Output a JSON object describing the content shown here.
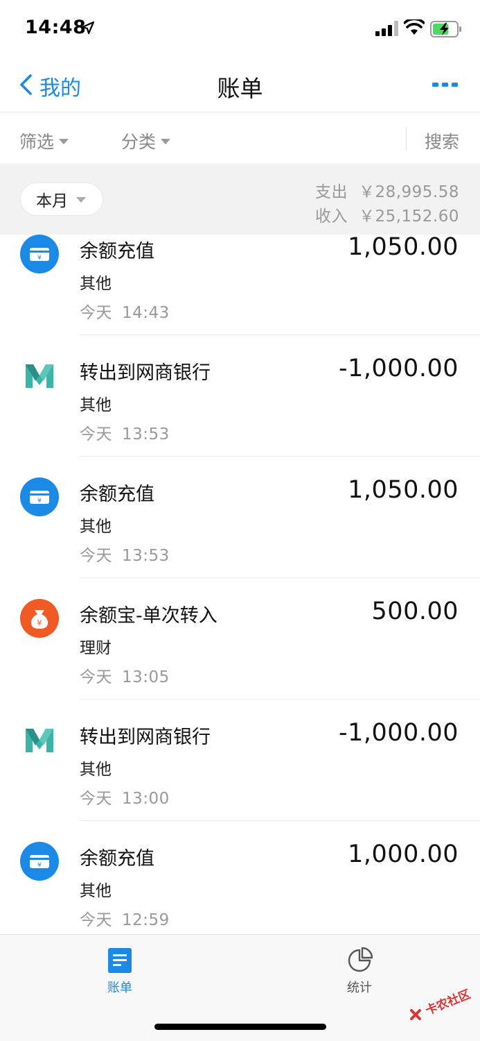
{
  "status_bar": {
    "time": "14:48"
  },
  "nav": {
    "back_label": "我的",
    "title": "账单"
  },
  "filters": {
    "filter_label": "筛选",
    "category_label": "分类",
    "search_label": "搜索"
  },
  "summary": {
    "period": "本月",
    "expense_label": "支出",
    "expense_amount": "￥28,995.58",
    "income_label": "收入",
    "income_amount": "￥25,152.60"
  },
  "transactions": [
    {
      "title": "余额充值",
      "category": "其他",
      "day": "今天",
      "time": "14:43",
      "amount": "1,050.00",
      "icon": "balance-card-icon"
    },
    {
      "title": "转出到网商银行",
      "category": "其他",
      "day": "今天",
      "time": "13:53",
      "amount": "-1,000.00",
      "icon": "mybank-logo-icon"
    },
    {
      "title": "余额充值",
      "category": "其他",
      "day": "今天",
      "time": "13:53",
      "amount": "1,050.00",
      "icon": "balance-card-icon"
    },
    {
      "title": "余额宝-单次转入",
      "category": "理财",
      "day": "今天",
      "time": "13:05",
      "amount": "500.00",
      "icon": "yuebao-moneybag-icon"
    },
    {
      "title": "转出到网商银行",
      "category": "其他",
      "day": "今天",
      "time": "13:00",
      "amount": "-1,000.00",
      "icon": "mybank-logo-icon"
    },
    {
      "title": "余额充值",
      "category": "其他",
      "day": "今天",
      "time": "12:59",
      "amount": "1,000.00",
      "icon": "balance-card-icon"
    }
  ],
  "tabs": [
    {
      "label": "账单",
      "icon": "bill-list-icon",
      "active": true
    },
    {
      "label": "统计",
      "icon": "pie-chart-icon",
      "active": false
    }
  ],
  "watermark": {
    "text": "卡农社区"
  },
  "colors": {
    "accent": "#1a8ae6",
    "yuebao": "#f05a24",
    "mybank": "#3bb5a8"
  }
}
